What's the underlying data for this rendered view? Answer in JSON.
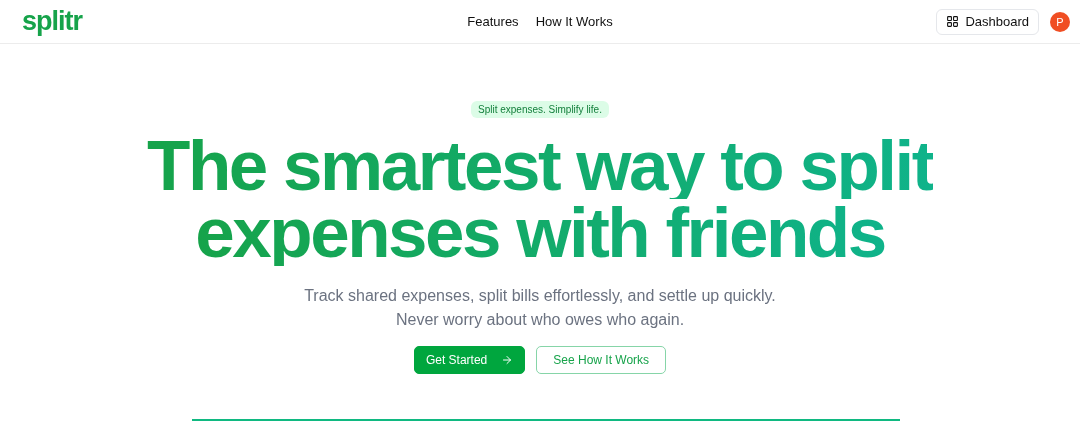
{
  "header": {
    "logo": "splitr",
    "nav": [
      "Features",
      "How It Works"
    ],
    "dashboard_button": "Dashboard",
    "avatar": "P"
  },
  "hero": {
    "badge": "Split expenses. Simplify life.",
    "headline": [
      "The smartest way to split",
      "expenses with friends"
    ],
    "subtitle": "Track shared expenses, split bills effortlessly, and settle up quickly. Never worry about who owes who again.",
    "buttons": [
      {
        "label": "Get Started",
        "kind": "primary"
      },
      {
        "label": "See How It Works",
        "kind": "outline"
      }
    ]
  }
}
